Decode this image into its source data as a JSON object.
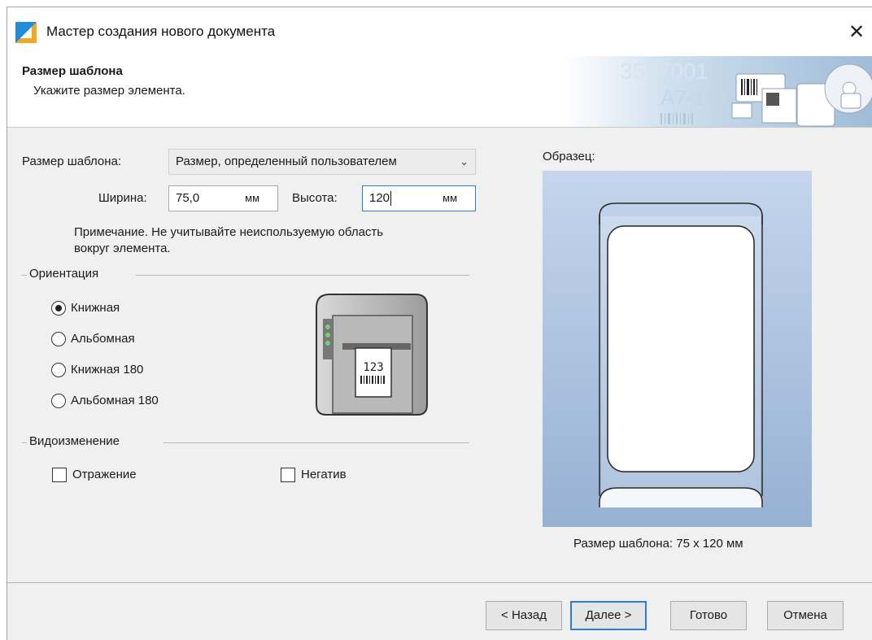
{
  "window": {
    "title": "Мастер создания нового документа",
    "close_glyph": "✕"
  },
  "header": {
    "title": "Размер шаблона",
    "subtitle": "Укажите размер элемента.",
    "art_text_1": "3597001",
    "art_text_2": "A7-118"
  },
  "form": {
    "size_label": "Размер шаблона:",
    "size_value": "Размер, определенный пользователем",
    "width_label": "Ширина:",
    "width_value": "75,0",
    "width_unit": "мм",
    "height_label": "Высота:",
    "height_value": "120",
    "height_unit": "мм",
    "note_line1": "Примечание. Не учитывайте неиспользуемую область",
    "note_line2": "вокруг элемента."
  },
  "orientation": {
    "title": "Ориентация",
    "options": [
      "Книжная",
      "Альбомная",
      "Книжная 180",
      "Альбомная 180"
    ],
    "selected_index": 0
  },
  "transform": {
    "title": "Видоизменение",
    "mirror_label": "Отражение",
    "mirror_checked": false,
    "negative_label": "Негатив",
    "negative_checked": false
  },
  "printer_label": "123",
  "preview": {
    "label": "Образец:",
    "caption": "Размер шаблона:  75 x 120 мм"
  },
  "buttons": {
    "back": "< Назад",
    "next": "Далее >",
    "finish": "Готово",
    "cancel": "Отмена"
  },
  "colors": {
    "accent": "#2f7bd9",
    "preview_top": "#c4d5ec",
    "preview_bottom": "#97b1d3"
  },
  "icons": {
    "app": "wizard-app-icon",
    "close": "close-icon",
    "dropdown": "chevron-down-icon",
    "printer": "label-printer-icon"
  }
}
